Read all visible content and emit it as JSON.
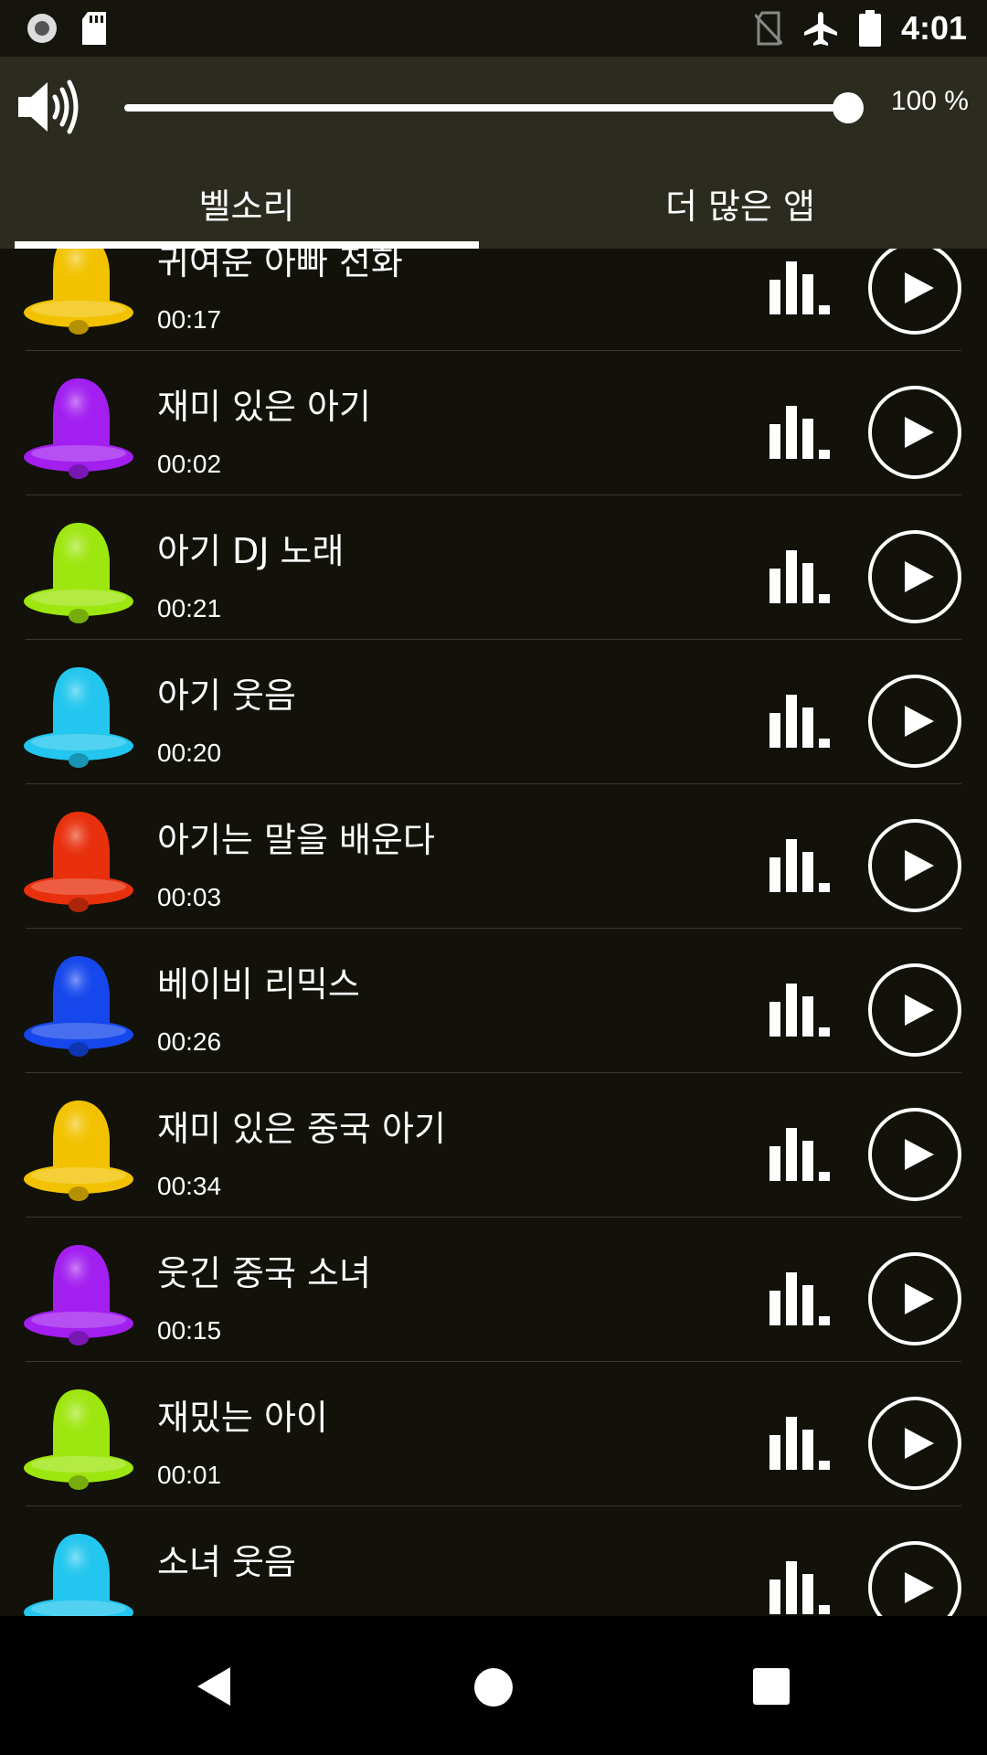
{
  "status_bar": {
    "time": "4:01",
    "icons": [
      "record-icon",
      "sd-card-icon",
      "no-sim-icon",
      "airplane-mode-icon",
      "battery-icon"
    ]
  },
  "volume": {
    "icon": "speaker-icon",
    "level": 1.0,
    "label": "100 %"
  },
  "tabs": [
    {
      "label": "벨소리",
      "selected": true
    },
    {
      "label": "더 많은 앱",
      "selected": false
    }
  ],
  "ringtones": [
    {
      "title": "귀여운 아빠 전화",
      "duration": "00:17",
      "bell_color": "#f2c200"
    },
    {
      "title": "재미 있은 아기",
      "duration": "00:02",
      "bell_color": "#a21ff0"
    },
    {
      "title": "아기 DJ 노래",
      "duration": "00:21",
      "bell_color": "#9ee60f"
    },
    {
      "title": "아기 웃음",
      "duration": "00:20",
      "bell_color": "#22c6ee"
    },
    {
      "title": "아기는 말을 배운다",
      "duration": "00:03",
      "bell_color": "#e8300d"
    },
    {
      "title": "베이비 리믹스",
      "duration": "00:26",
      "bell_color": "#1547ec"
    },
    {
      "title": "재미 있은 중국 아기",
      "duration": "00:34",
      "bell_color": "#f2c200"
    },
    {
      "title": "웃긴 중국 소녀",
      "duration": "00:15",
      "bell_color": "#a21ff0"
    },
    {
      "title": "재밌는 아이",
      "duration": "00:01",
      "bell_color": "#9ee60f"
    },
    {
      "title": "소녀 웃음",
      "duration": "",
      "bell_color": "#22c6ee"
    }
  ],
  "nav_bar": {
    "icons": [
      "back-icon",
      "home-icon",
      "recents-icon"
    ]
  }
}
